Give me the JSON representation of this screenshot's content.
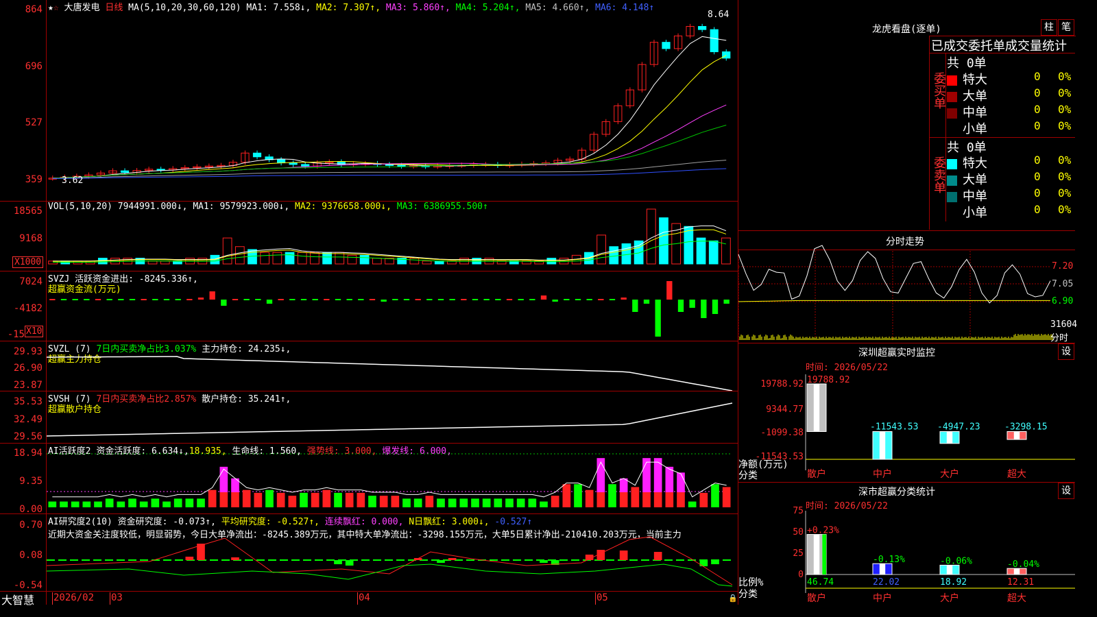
{
  "main": {
    "stock_name": "大唐发电",
    "period": "日线",
    "ma_title": "MA(5,10,20,30,60,120)",
    "ma": [
      {
        "label": "MA1: 7.558↓,",
        "color": "#ffffff"
      },
      {
        "label": "MA2: 7.307↑,",
        "color": "#ffff00"
      },
      {
        "label": "MA3: 5.860↑,",
        "color": "#ff40ff"
      },
      {
        "label": "MA4: 5.204↑,",
        "color": "#00ff00"
      },
      {
        "label": "MA5: 4.660↑,",
        "color": "#c0c0c0"
      },
      {
        "label": "MA6: 4.148↑",
        "color": "#4060ff"
      }
    ],
    "y_ticks": [
      "864",
      "696",
      "527",
      "359"
    ],
    "high_label": "8.64",
    "low_label": "3.62",
    "closes": [
      3.62,
      3.65,
      3.68,
      3.72,
      3.78,
      3.85,
      3.8,
      3.86,
      3.9,
      3.88,
      3.92,
      3.95,
      3.98,
      4.0,
      4.02,
      4.12,
      4.41,
      4.29,
      4.2,
      4.1,
      4.05,
      4.0,
      4.1,
      4.13,
      4.05,
      4.07,
      4.08,
      4.05,
      4.02,
      4.0,
      4.01,
      3.99,
      4.0,
      4.02,
      4.03,
      4.05,
      4.05,
      4.02,
      4.04,
      4.06,
      4.08,
      4.1,
      4.18,
      4.22,
      4.5,
      5.0,
      5.4,
      5.9,
      6.4,
      7.2,
      7.9,
      7.7,
      8.1,
      8.4,
      8.3,
      7.6,
      7.4
    ]
  },
  "vol": {
    "title": "VOL(5,10,20)",
    "value": "7944991.000↓,",
    "ma": [
      {
        "label": "MA1: 9579923.000↓,",
        "color": "#ffffff"
      },
      {
        "label": "MA2: 9376658.000↓,",
        "color": "#ffff00"
      },
      {
        "label": "MA3: 6386955.500↑",
        "color": "#00ff00"
      }
    ],
    "y_ticks": [
      "18565",
      "9168"
    ],
    "unit": "X1000",
    "bars": [
      1,
      1,
      1,
      1,
      2,
      2,
      2,
      2,
      1,
      1,
      1,
      2,
      2,
      3,
      9,
      6,
      5,
      4,
      4,
      4,
      4,
      4,
      4,
      4,
      3,
      3,
      2,
      2,
      2,
      2,
      1,
      1,
      1,
      2,
      2,
      2,
      1,
      1,
      1,
      1,
      2,
      2,
      3,
      4,
      10,
      6,
      7,
      8,
      19,
      16,
      14,
      13,
      9,
      8,
      9
    ]
  },
  "svzj": {
    "title": "SVZJ",
    "label1": "活跃资金进出: -8245.336↑,",
    "label2": "超赢资金流(万元)",
    "y_ticks": [
      "7024",
      "-4182",
      "-15"
    ],
    "unit": "X10",
    "bars": [
      0,
      0,
      0,
      0,
      0,
      0,
      0,
      0,
      0,
      0,
      0,
      0,
      0,
      1,
      4,
      -3,
      0,
      0,
      0,
      -2,
      0,
      0,
      0,
      0,
      0,
      0,
      0,
      0,
      0,
      -1,
      0,
      0,
      0,
      0,
      0,
      0,
      0,
      0,
      0,
      0,
      0,
      0,
      0,
      2,
      -1,
      0,
      0,
      0,
      0,
      0,
      1,
      -6,
      -2,
      -18,
      9,
      -6,
      -4,
      -9,
      -7,
      -2
    ]
  },
  "svzl": {
    "title": "SVZL (7)",
    "label1": "7日内买卖净占比3.037%",
    "label2": "主力持仓: 24.235↓,",
    "label3": "超赢主力持仓",
    "y_ticks": [
      "29.93",
      "26.90",
      "23.87"
    ]
  },
  "svsh": {
    "title": "SVSH (7)",
    "label1": "7日内买卖净占比2.857%",
    "label2": "散户持仓: 35.241↑,",
    "label3": "超赢散户持仓",
    "y_ticks": [
      "35.53",
      "32.49",
      "29.56"
    ]
  },
  "ai": {
    "title": "AI活跃度2",
    "label1": "资金活跃度: 6.634↓,",
    "label2": "18.935,",
    "label3": "生命线: 1.560,",
    "label4": "强势线: 3.000,",
    "label5": "爆发线: 6.000,",
    "y_ticks": [
      "18.94",
      "9.35",
      "0.00"
    ]
  },
  "research": {
    "title": "AI研究度2(10)",
    "label1": "资金研究度: -0.073↑,",
    "label2": "平均研究度: -0.527↑,",
    "label3": "连续飘红: 0.000,",
    "label4": "N日飘红: 3.000↓,",
    "label5": "-0.527↑",
    "comment": "近期大资金关注度较低，明显弱势，今日大单净流出：-8245.389万元，其中特大单净流出：-3298.155万元，大单5日累计净出-210410.203万元，当前主力",
    "y_ticks": [
      "0.70",
      "0.08",
      "-0.54"
    ]
  },
  "bottom": {
    "brand": "大智慧",
    "dates": [
      "2026/02",
      "03",
      "04",
      "05"
    ]
  },
  "dragon": {
    "title": "龙虎看盘(逐单)",
    "btn1": "柱",
    "btn2": "笔",
    "header": "已成交委托单成交量统计",
    "buy_label": "委买单",
    "sell_label": "委卖单",
    "buy_total": "共 0单",
    "sell_total": "共 0单",
    "buy_rows": [
      {
        "name": "特大",
        "count": "0",
        "pct": "0%",
        "color": "#ff0000"
      },
      {
        "name": "大单",
        "count": "0",
        "pct": "0%",
        "color": "#a00000"
      },
      {
        "name": "中单",
        "count": "0",
        "pct": "0%",
        "color": "#800000"
      },
      {
        "name": "小单",
        "count": "0",
        "pct": "0%",
        "color": ""
      }
    ],
    "sell_rows": [
      {
        "name": "特大",
        "count": "0",
        "pct": "0%",
        "color": "#00ffff"
      },
      {
        "name": "大单",
        "count": "0",
        "pct": "0%",
        "color": "#008b8b"
      },
      {
        "name": "中单",
        "count": "0",
        "pct": "0%",
        "color": "#007070"
      },
      {
        "name": "小单",
        "count": "0",
        "pct": "0%",
        "color": ""
      }
    ]
  },
  "intraday": {
    "title": "分时走势",
    "y_ticks": [
      "7.20",
      "7.05",
      "6.90"
    ],
    "vol_tick": "31604",
    "vol_label": "分时"
  },
  "monitor": {
    "title": "深圳超赢实时监控",
    "btn": "设",
    "time": "时间: 2026/05/22",
    "y_ticks": [
      "19788.92",
      "9344.77",
      "-1099.38",
      "-11543.53"
    ],
    "ylabel": "净额(万元)",
    "xlabel": "分类",
    "chart_data": {
      "type": "bar",
      "categories": [
        "散户",
        "中户",
        "大户",
        "超大"
      ],
      "values": [
        19788.92,
        -11543.53,
        -4947.23,
        -3298.15
      ],
      "value_labels": [
        "19788.92",
        "-11543.53",
        "-4947.23",
        "-3298.15"
      ],
      "ylim": [
        -11543.53,
        19788.92
      ]
    }
  },
  "classify": {
    "title": "深市超赢分类统计",
    "btn": "设",
    "time": "时间: 2026/05/22",
    "y_ticks": [
      "75",
      "50",
      "25",
      "0"
    ],
    "ylabel": "比例%",
    "xlabel": "分类",
    "chart_data": {
      "type": "bar",
      "categories": [
        "散户",
        "中户",
        "大户",
        "超大"
      ],
      "values": [
        46.74,
        22.02,
        18.92,
        12.31
      ],
      "changes": [
        "+0.23%",
        "-0.13%",
        "-0.06%",
        "-0.04%"
      ],
      "ylim": [
        0,
        75
      ]
    }
  }
}
